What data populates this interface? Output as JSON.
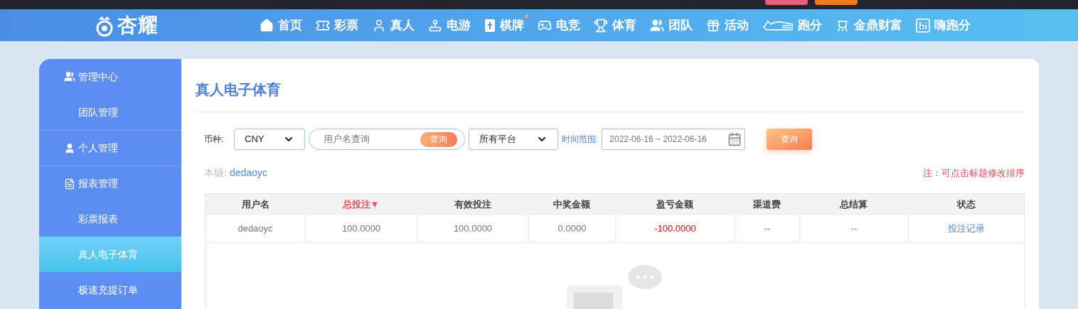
{
  "top_bar": {
    "buttons": [
      {
        "color": "#ec5f7b"
      },
      {
        "color": "#f57a1f"
      }
    ]
  },
  "brand": {
    "name": "杏耀"
  },
  "nav": [
    {
      "label": "首页",
      "dot": false
    },
    {
      "label": "彩票",
      "dot": false
    },
    {
      "label": "真人",
      "dot": false
    },
    {
      "label": "电游",
      "dot": false
    },
    {
      "label": "棋牌",
      "dot": true
    },
    {
      "label": "电竞",
      "dot": false
    },
    {
      "label": "体育",
      "dot": false
    },
    {
      "label": "团队",
      "dot": false
    },
    {
      "label": "活动",
      "dot": false
    },
    {
      "label": "跑分",
      "dot": false
    },
    {
      "label": "金鼎财富",
      "dot": false
    },
    {
      "label": "嗨跑分",
      "dot": false
    }
  ],
  "sidebar": [
    {
      "kind": "header",
      "label": "管理中心",
      "selected": false
    },
    {
      "kind": "link",
      "label": "团队管理",
      "selected": false
    },
    {
      "kind": "header",
      "label": "个人管理",
      "selected": false
    },
    {
      "kind": "header",
      "label": "报表管理",
      "selected": false
    },
    {
      "kind": "link",
      "label": "彩票报表",
      "selected": false
    },
    {
      "kind": "link",
      "label": "真人电子体育",
      "selected": true
    },
    {
      "kind": "link",
      "label": "极速充提订单",
      "selected": false
    }
  ],
  "page_title": "真人电子体育",
  "filters": {
    "currency_label": "币种:",
    "currency": "CNY",
    "username": {
      "placeholder": "用户名查询",
      "button": "查询"
    },
    "platform": "所有平台",
    "date_label": "时间范围:",
    "date_range": "2022-06-16 ~ 2022-06-16",
    "search_button": "查询"
  },
  "level": {
    "label": "本级:",
    "value": "dedaoyc"
  },
  "note": "注：可点击标题修改排序",
  "table": {
    "columns": [
      {
        "label": "用户名",
        "sorted": false
      },
      {
        "label": "总投注▼",
        "sorted": true
      },
      {
        "label": "有效投注",
        "sorted": false
      },
      {
        "label": "中奖金额",
        "sorted": false
      },
      {
        "label": "盈亏金额",
        "sorted": false
      },
      {
        "label": "渠道费",
        "sorted": false
      },
      {
        "label": "总结算",
        "sorted": false
      },
      {
        "label": "状态",
        "sorted": false
      }
    ],
    "rows": [
      [
        {
          "kind": "text",
          "text": "dedaoyc"
        },
        {
          "kind": "text",
          "text": "100.0000"
        },
        {
          "kind": "text",
          "text": "100.0000"
        },
        {
          "kind": "text",
          "text": "0.0000"
        },
        {
          "kind": "negative",
          "text": "-100.0000"
        },
        {
          "kind": "text",
          "text": "--"
        },
        {
          "kind": "text",
          "text": "--"
        },
        {
          "kind": "link",
          "text": "投注记录"
        }
      ]
    ]
  }
}
